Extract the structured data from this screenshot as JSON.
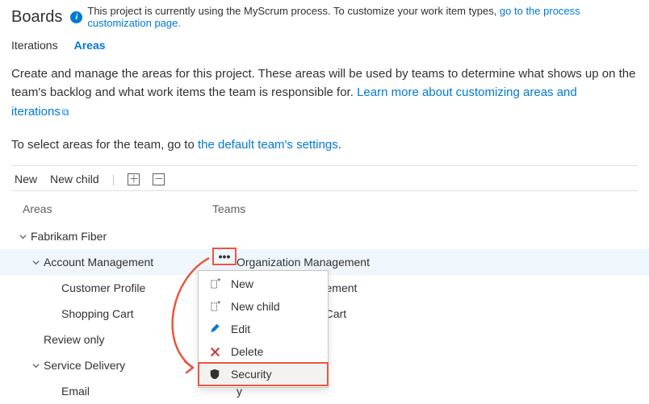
{
  "page": {
    "title": "Boards"
  },
  "banner": {
    "text_before_link": "This project is currently using the MyScrum process. To customize your work item types, ",
    "link": "go to the process customization page."
  },
  "tabs": {
    "iterations": "Iterations",
    "areas": "Areas"
  },
  "intro": {
    "line1": "Create and manage the areas for this project. These areas will be used by teams to determine what shows up on the team's backlog and what work items the team is responsible for. ",
    "link1": "Learn more about customizing areas and iterations",
    "line2_before": "To select areas for the team, go to ",
    "link2": "the default team's settings",
    "line2_after": "."
  },
  "toolbar": {
    "new": "New",
    "new_child": "New child"
  },
  "columns": {
    "areas": "Areas",
    "teams": "Teams"
  },
  "tree": [
    {
      "indent": 1,
      "chev": true,
      "label": "Fabrikam Fiber",
      "teams": ""
    },
    {
      "indent": 2,
      "chev": true,
      "label": "Account Management",
      "teams": "Organization Management",
      "selected": true
    },
    {
      "indent": 3,
      "chev": false,
      "label": "Customer Profile",
      "teams": "ganization Management"
    },
    {
      "indent": 3,
      "chev": false,
      "label": "Shopping Cart",
      "teams": "ement, Shopping Cart"
    },
    {
      "indent": 2,
      "chev": false,
      "label": "Review only",
      "teams": ""
    },
    {
      "indent": 2,
      "chev": true,
      "label": "Service Delivery",
      "teams": ""
    },
    {
      "indent": 3,
      "chev": false,
      "label": "Email",
      "teams": "y"
    }
  ],
  "menu": {
    "new": "New",
    "new_child": "New child",
    "edit": "Edit",
    "delete": "Delete",
    "security": "Security"
  }
}
